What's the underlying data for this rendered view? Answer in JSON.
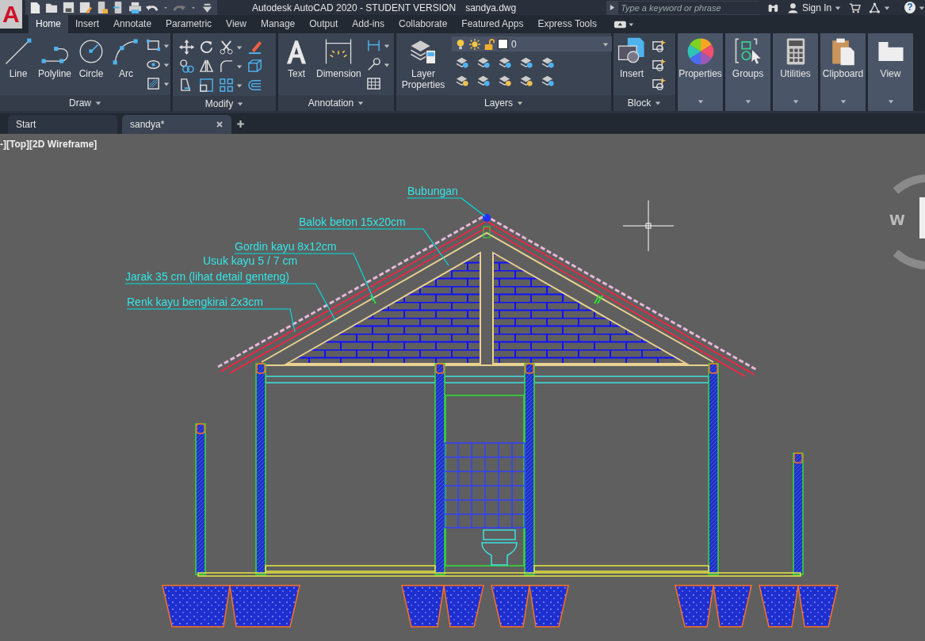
{
  "title_bar": {
    "app_menu": "A",
    "title": "Autodesk AutoCAD 2020 - STUDENT VERSION",
    "file_name": "sandya.dwg",
    "search": {
      "placeholder": "Type a keyword or phrase"
    },
    "sign_in": "Sign In",
    "help": "?"
  },
  "ribbon_tabs": [
    {
      "label": "Home",
      "selected": true
    },
    {
      "label": "Insert",
      "selected": false
    },
    {
      "label": "Annotate",
      "selected": false
    },
    {
      "label": "Parametric",
      "selected": false
    },
    {
      "label": "View",
      "selected": false
    },
    {
      "label": "Manage",
      "selected": false
    },
    {
      "label": "Output",
      "selected": false
    },
    {
      "label": "Add-ins",
      "selected": false
    },
    {
      "label": "Collaborate",
      "selected": false
    },
    {
      "label": "Featured Apps",
      "selected": false
    },
    {
      "label": "Express Tools",
      "selected": false
    }
  ],
  "panels": [
    {
      "kind": "draw",
      "title": "Draw",
      "tools": [
        "Line",
        "Polyline",
        "Circle",
        "Arc"
      ]
    },
    {
      "kind": "modify",
      "title": "Modify"
    },
    {
      "kind": "annotation",
      "title": "Annotation",
      "tools": [
        "Text",
        "Dimension"
      ]
    },
    {
      "kind": "layers",
      "title": "Layers",
      "tools": [
        "Layer Properties"
      ],
      "layer": "0"
    },
    {
      "kind": "block",
      "title": "Block",
      "tools": [
        "Insert"
      ]
    }
  ],
  "collapsed_panels": [
    {
      "kind": "properties",
      "title": "Properties"
    },
    {
      "kind": "groups",
      "title": "Groups"
    },
    {
      "kind": "utilities",
      "title": "Utilities"
    },
    {
      "kind": "clipboard",
      "title": "Clipboard"
    },
    {
      "kind": "view",
      "title": "View"
    }
  ],
  "file_tabs": [
    {
      "label": "Start",
      "selected": false
    },
    {
      "label": "sandya*",
      "selected": true
    }
  ],
  "viewport": {
    "label": "-][Top][2D Wireframe]",
    "viewcube_label": "W",
    "annotations": [
      "Bubungan",
      "Balok beton 15x20cm",
      "Gordin kayu 8x12cm",
      "Usuk kayu 5 / 7 cm",
      "Jarak 35 cm (lihat detail genteng)",
      "Renk kayu bengkirai 2x3cm"
    ]
  }
}
